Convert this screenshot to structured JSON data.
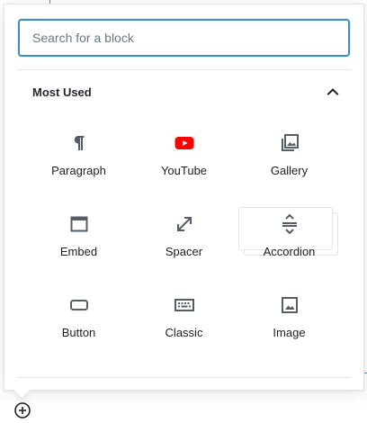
{
  "search": {
    "placeholder": "Search for a block",
    "value": ""
  },
  "panel": {
    "title": "Most Used",
    "expanded": true
  },
  "blocks": [
    {
      "label": "Paragraph",
      "icon": "paragraph-icon"
    },
    {
      "label": "YouTube",
      "icon": "youtube-icon"
    },
    {
      "label": "Gallery",
      "icon": "gallery-icon"
    },
    {
      "label": "Embed",
      "icon": "embed-icon"
    },
    {
      "label": "Spacer",
      "icon": "spacer-icon"
    },
    {
      "label": "Accordion",
      "icon": "accordion-icon"
    },
    {
      "label": "Button",
      "icon": "button-icon"
    },
    {
      "label": "Classic",
      "icon": "keyboard-icon"
    },
    {
      "label": "Image",
      "icon": "image-icon"
    }
  ],
  "colors": {
    "accent": "#3b8fc5",
    "youtube": "#ff0000",
    "icon": "#555d66",
    "border": "#e2e4e7"
  }
}
